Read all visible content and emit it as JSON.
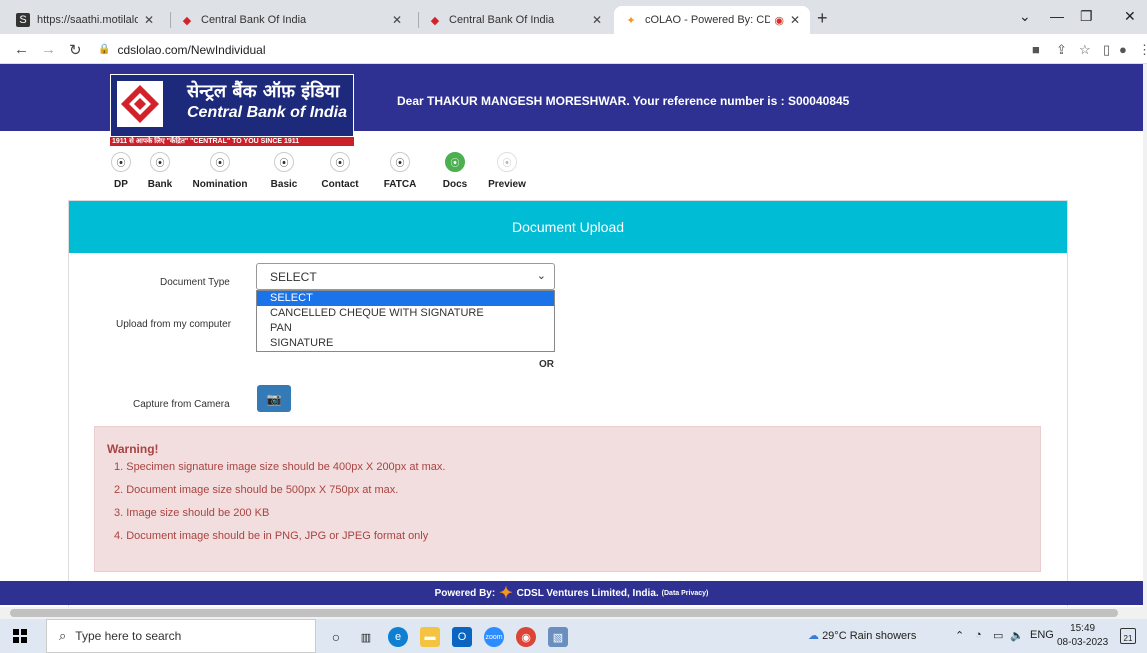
{
  "browser": {
    "tabs": [
      {
        "title": "https://saathi.motilaloswal.com/E",
        "active": false
      },
      {
        "title": "Central Bank Of India",
        "active": false
      },
      {
        "title": "Central Bank Of India",
        "active": false
      },
      {
        "title": "cOLAO - Powered By: CDSL \\",
        "active": true
      }
    ],
    "url": "cdslolao.com/NewIndividual"
  },
  "header": {
    "bank_name_hindi": "सेन्ट्रल बैंक ऑफ़ इंडिया",
    "bank_name": "Central Bank of India",
    "tagline": "1911 से आपके लिए \"केंद्रित\"   \"CENTRAL\" TO YOU SINCE 1911",
    "greeting": "Dear THAKUR MANGESH MORESHWAR. Your reference number is : S00040845",
    "brand_color": "#2e3192"
  },
  "steps": [
    {
      "label": "DP",
      "state": "done"
    },
    {
      "label": "Bank",
      "state": "done"
    },
    {
      "label": "Nomination",
      "state": "done"
    },
    {
      "label": "Basic",
      "state": "done"
    },
    {
      "label": "Contact",
      "state": "done"
    },
    {
      "label": "FATCA",
      "state": "done"
    },
    {
      "label": "Docs",
      "state": "active"
    },
    {
      "label": "Preview",
      "state": "pending"
    }
  ],
  "card": {
    "title": "Document Upload",
    "doc_type_label": "Document Type",
    "upload_label": "Upload from my computer",
    "camera_label": "Capture from Camera",
    "or_label": "OR",
    "select_value": "SELECT",
    "options": [
      "SELECT",
      "CANCELLED CHEQUE WITH SIGNATURE",
      "PAN",
      "SIGNATURE"
    ]
  },
  "warning": {
    "heading": "Warning!",
    "items": [
      "1. Specimen signature image size should be 400px X 200px at max.",
      "2. Document image size should be 500px X 750px at max.",
      "3. Image size should be 200 KB",
      "4. Document image should be in PNG, JPG or JPEG format only"
    ]
  },
  "footer": {
    "powered": "Powered By:",
    "company": "CDSL Ventures Limited, India.",
    "privacy": "(Data Privacy)"
  },
  "taskbar": {
    "search_placeholder": "Type here to search",
    "weather": "29°C  Rain showers",
    "lang": "ENG",
    "time": "15:49",
    "date": "08-03-2023",
    "notifications": "21"
  }
}
